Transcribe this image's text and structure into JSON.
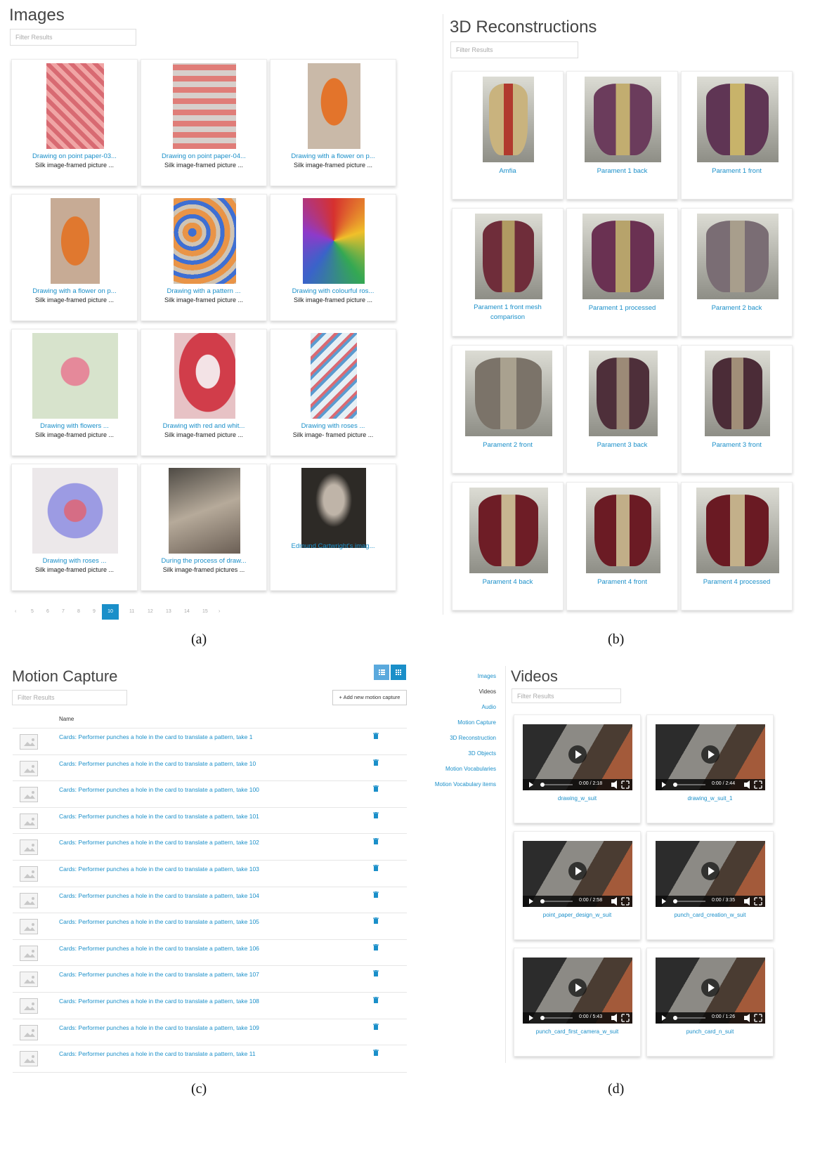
{
  "panel_a": {
    "title": "Images",
    "filter_placeholder": "Filter Results",
    "cards": [
      {
        "title": "Drawing on point paper-03...",
        "subtitle": "Silk image-framed picture ..."
      },
      {
        "title": "Drawing on point paper-04...",
        "subtitle": "Silk image-framed picture ..."
      },
      {
        "title": "Drawing with a flower on p...",
        "subtitle": "Silk image-framed picture ..."
      },
      {
        "title": "Drawing with a flower on p...",
        "subtitle": "Silk image-framed picture ..."
      },
      {
        "title": "Drawing with a pattern ...",
        "subtitle": "Silk image-framed picture ..."
      },
      {
        "title": "Drawing with colourful ros...",
        "subtitle": "Silk image-framed picture ..."
      },
      {
        "title": "Drawing with flowers ...",
        "subtitle": "Silk image-framed picture ..."
      },
      {
        "title": "Drawing with red and whit...",
        "subtitle": "Silk image-framed picture ..."
      },
      {
        "title": "Drawing with roses ...",
        "subtitle": "Silk image- framed picture ..."
      },
      {
        "title": "Drawing with roses ...",
        "subtitle": "Silk image-framed picture ..."
      },
      {
        "title": "During the process of draw...",
        "subtitle": "Silk image-framed pictures ..."
      },
      {
        "title": "Edmund Cartwright's imag...",
        "subtitle": ""
      }
    ],
    "pagination": {
      "prev": "‹",
      "pages": [
        "5",
        "6",
        "7",
        "8",
        "9",
        "10",
        "11",
        "12",
        "13",
        "14",
        "15"
      ],
      "active": "10",
      "next": "›"
    }
  },
  "panel_b": {
    "title": "3D Reconstructions",
    "filter_placeholder": "Filter Results",
    "cards": [
      {
        "title": "Amfia"
      },
      {
        "title": "Parament 1 back"
      },
      {
        "title": "Parament 1 front"
      },
      {
        "title": "Parament 1 front mesh",
        "title2": "comparison"
      },
      {
        "title": "Parament 1 processed"
      },
      {
        "title": "Parament 2 back"
      },
      {
        "title": "Parament 2 front"
      },
      {
        "title": "Parament 3 back"
      },
      {
        "title": "Parament 3 front"
      },
      {
        "title": "Parament 4 back"
      },
      {
        "title": "Parament 4 front"
      },
      {
        "title": "Parament 4 processed"
      }
    ]
  },
  "panel_c": {
    "title": "Motion Capture",
    "filter_placeholder": "Filter Results",
    "add_button": "+ Add new motion capture",
    "column_name": "Name",
    "rows": [
      "Cards: Performer punches a hole in the card to translate a pattern, take 1",
      "Cards: Performer punches a hole in the card to translate a pattern, take 10",
      "Cards: Performer punches a hole in the card to translate a pattern, take 100",
      "Cards: Performer punches a hole in the card to translate a pattern, take 101",
      "Cards: Performer punches a hole in the card to translate a pattern, take 102",
      "Cards: Performer punches a hole in the card to translate a pattern, take 103",
      "Cards: Performer punches a hole in the card to translate a pattern, take 104",
      "Cards: Performer punches a hole in the card to translate a pattern, take 105",
      "Cards: Performer punches a hole in the card to translate a pattern, take 106",
      "Cards: Performer punches a hole in the card to translate a pattern, take 107",
      "Cards: Performer punches a hole in the card to translate a pattern, take 108",
      "Cards: Performer punches a hole in the card to translate a pattern, take 109",
      "Cards: Performer punches a hole in the card to translate a pattern, take 11"
    ]
  },
  "panel_d": {
    "title": "Videos",
    "filter_placeholder": "Filter Results",
    "nav": [
      "Images",
      "Videos",
      "Audio",
      "Motion Capture",
      "3D Reconstruction",
      "3D Objects",
      "Motion Vocabularies",
      "Motion Vocabulary items"
    ],
    "videos": [
      {
        "name": "drawing_w_suit",
        "time": "0:00 / 2:18"
      },
      {
        "name": "drawing_w_suit_1",
        "time": "0:00 / 2:44"
      },
      {
        "name": "point_paper_design_w_suit",
        "time": "0:00 / 2:58"
      },
      {
        "name": "punch_card_creation_w_suit",
        "time": "0:00 / 3:35"
      },
      {
        "name": "punch_card_first_camera_w_suit",
        "time": "0:00 / 5:43"
      },
      {
        "name": "punch_card_n_suit",
        "time": "0:00 / 1:26"
      }
    ]
  },
  "captions": {
    "a": "(a)",
    "b": "(b)",
    "c": "(c)",
    "d": "(d)"
  },
  "colors": {
    "link": "#1a8fc9",
    "accent_button": "#1a8fc9"
  }
}
